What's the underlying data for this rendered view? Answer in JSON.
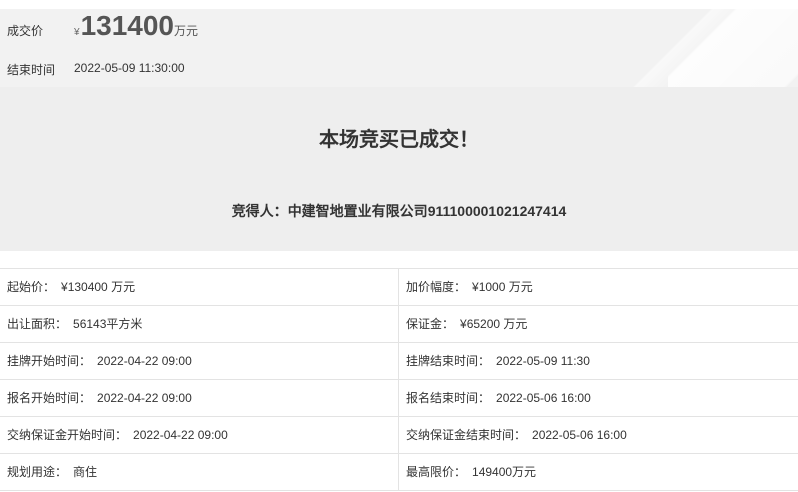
{
  "summary": {
    "price_label": "成交价",
    "price_currency": "¥",
    "price_value": "131400",
    "price_unit": "万元",
    "end_time_label": "结束时间",
    "end_time_value": "2022-05-09 11:30:00"
  },
  "result": {
    "title": "本场竞买已成交！",
    "winner_label": "竞得人：",
    "winner_name": "中建智地置业有限公司",
    "winner_code": "911100001021247414"
  },
  "details": [
    [
      {
        "label": "起始价：",
        "value": "¥130400 万元"
      },
      {
        "label": "加价幅度：",
        "value": "¥1000 万元"
      }
    ],
    [
      {
        "label": "出让面积：",
        "value": "56143平方米"
      },
      {
        "label": "保证金：",
        "value": "¥65200 万元"
      }
    ],
    [
      {
        "label": "挂牌开始时间：",
        "value": "2022-04-22 09:00"
      },
      {
        "label": "挂牌结束时间：",
        "value": "2022-05-09 11:30"
      }
    ],
    [
      {
        "label": "报名开始时间：",
        "value": "2022-04-22 09:00"
      },
      {
        "label": "报名结束时间：",
        "value": "2022-05-06 16:00"
      }
    ],
    [
      {
        "label": "交纳保证金开始时间：",
        "value": "2022-04-22 09:00"
      },
      {
        "label": "交纳保证金结束时间：",
        "value": "2022-05-06 16:00"
      }
    ],
    [
      {
        "label": "规划用途：",
        "value": "商住"
      },
      {
        "label": "最高限价：",
        "value": "149400万元"
      }
    ]
  ]
}
